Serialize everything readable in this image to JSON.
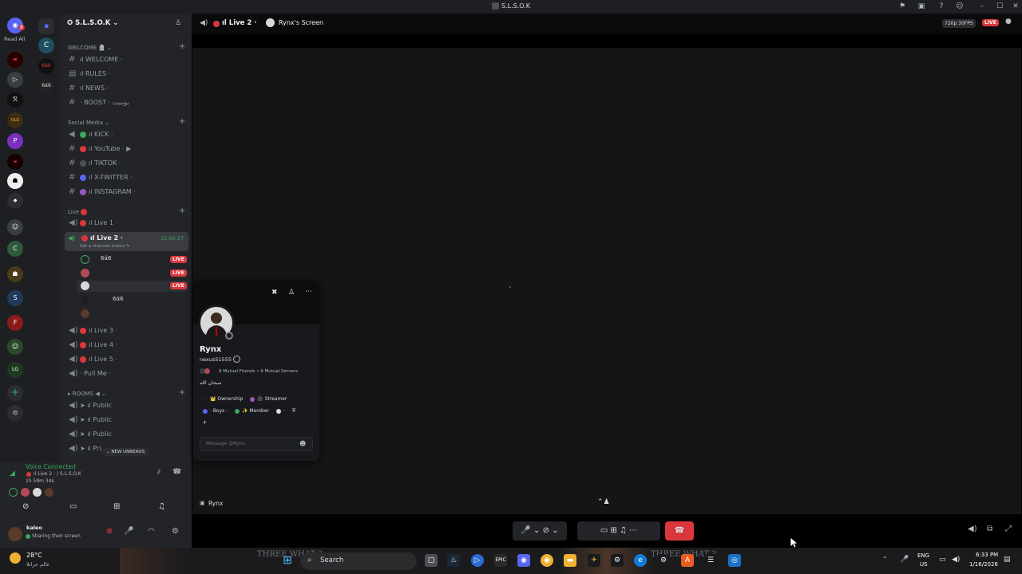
{
  "window": {
    "title": "S.L.S.O.K",
    "title_icons": [
      "flag-icon",
      "inbox-icon",
      "help-icon",
      "people-icon"
    ],
    "controls": [
      "—",
      "☐",
      "✕"
    ]
  },
  "rail": {
    "read_all": "Read All",
    "badge": "8"
  },
  "server": {
    "name": "S.L.S.O.K"
  },
  "categories": {
    "welcome": "WELCOME 🪦 ⌄",
    "social": "Social Media ⌄",
    "live": "Live",
    "rooms": "ROOMS ◀ ⌄"
  },
  "welcome_channels": [
    {
      "label": "ıl WELCOME ·"
    },
    {
      "label": "ıl RULES ·"
    },
    {
      "label": "ıl NEWS ·"
    },
    {
      "label": "· BOOST · بوست"
    }
  ],
  "social_channels": [
    {
      "label": "ıl KICK ·",
      "color": "#3ba55c"
    },
    {
      "label": "ıl YouTube · ▶",
      "color": "#da373c"
    },
    {
      "label": "ıl TIKTOK ·",
      "color": "#4e5058"
    },
    {
      "label": "ıl X-TWITTER ·",
      "color": "#5865f2"
    },
    {
      "label": "ıl INSTAGRAM ·",
      "color": "#9b59b6"
    }
  ],
  "live_channels": {
    "live1": "ıl Live 1 ·",
    "live2": "ıl Live 2 ·",
    "live2_timer": "15:00:27",
    "live2_status": "Set a channel status ✎",
    "members": [
      {
        "name": "6ά6",
        "live": "LIVE"
      },
      {
        "name": "",
        "live": "LIVE"
      },
      {
        "name": "",
        "live": "LIVE"
      },
      {
        "name": "6ά6",
        "live": ""
      },
      {
        "name": "",
        "live": ""
      }
    ],
    "live3": "ıl Live 3 ·",
    "live4": "ıl Live 4 ·",
    "live5": "ıl Live 5 ·",
    "pullme": "· Pull Me ·"
  },
  "rooms": [
    {
      "label": "ıl Public"
    },
    {
      "label": "ıl Public"
    },
    {
      "label": "ıl Public"
    },
    {
      "label": "ıl Pri..."
    }
  ],
  "new_unreads": "⌄ NEW UNREADS",
  "voice": {
    "status": "Voice Connected",
    "channel": "ıl Live 2 · / S.L.S.O.K",
    "elapsed": "1h 59m 34s",
    "user_name": "kaleo",
    "user_status": "Sharing their screen"
  },
  "stage": {
    "channel": "ıl Live 2 ·",
    "screen_owner": "Rynx's Screen",
    "quality": "720p 30FPS",
    "live": "LIVE",
    "footer_name": "Rynx"
  },
  "profile": {
    "name": "Rynx",
    "username": "nexus51555",
    "mutuals": "9 Mutual Friends • 9 Mutual Servers",
    "bio": "سبحان الله",
    "roles": [
      {
        "label": "👑 Ownership",
        "color": "#1e1f22"
      },
      {
        "label": "🎥 Streamer",
        "color": "#9b59b6"
      },
      {
        "label": "· Boys ·",
        "color": "#5865f2"
      },
      {
        "label": "✨ Member",
        "color": "#3ba55c"
      },
      {
        "label": "·",
        "color": "#dbdee1"
      }
    ],
    "message_placeholder": "Message @Rynx"
  },
  "taskbar": {
    "temp": "28°C",
    "weather_note": "عالم حزاتلا",
    "search": "Search",
    "lang": "ENG",
    "region": "US",
    "time": "6:33 PM",
    "date": "1/16/2026",
    "video_caption_left": "THREE WHAT ?",
    "video_caption_right": "THREE WHAT ?"
  }
}
